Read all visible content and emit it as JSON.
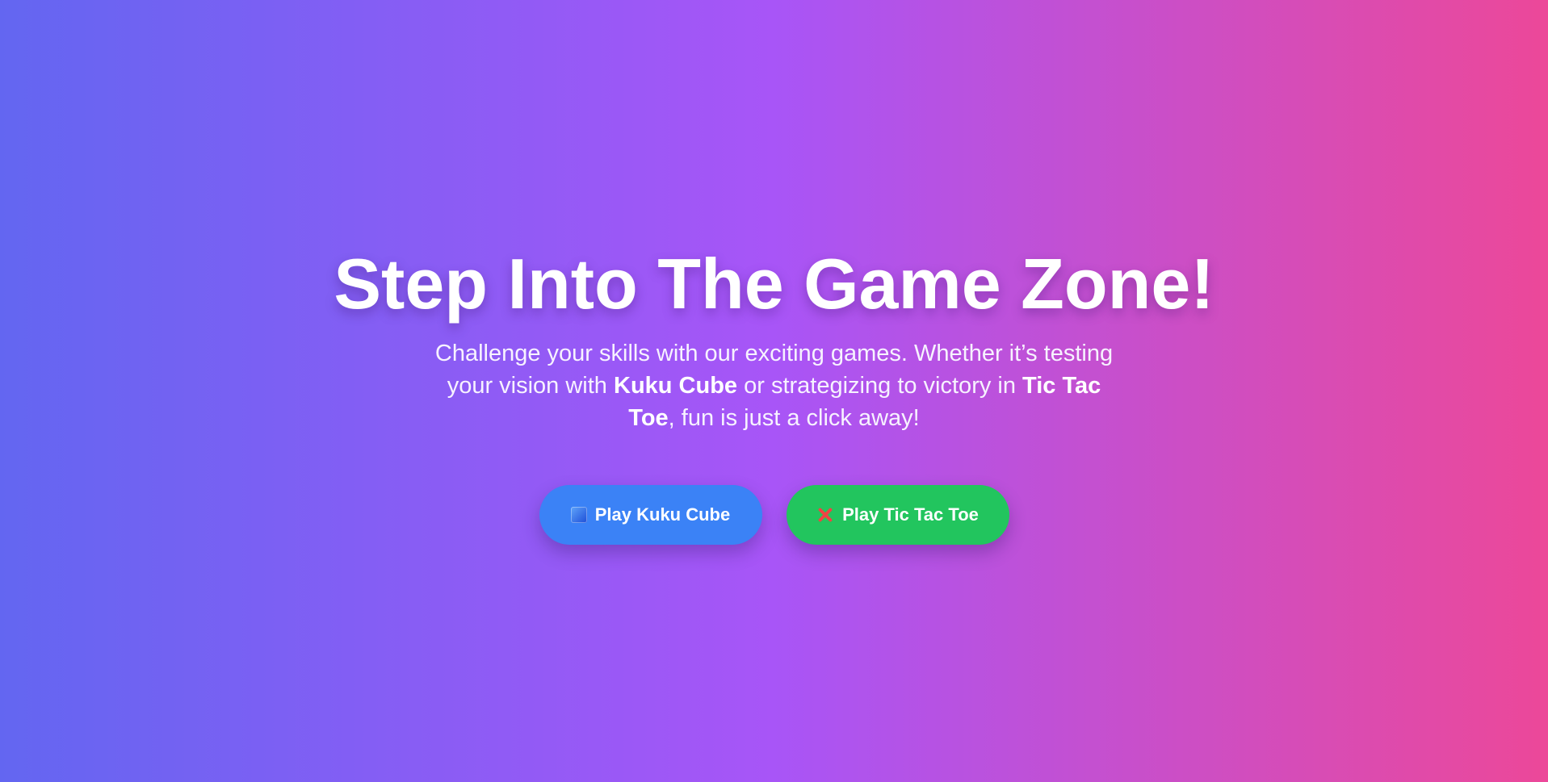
{
  "hero": {
    "title": "Step Into The Game Zone!",
    "description": {
      "part1": "Challenge your skills with our exciting games. Whether it’s testing your vision with ",
      "game1": "Kuku Cube",
      "part2": " or strategizing to victory in ",
      "game2": "Tic Tac Toe",
      "part3": ", fun is just a click away!"
    }
  },
  "buttons": [
    {
      "label": "Play Kuku Cube",
      "icon": "blue-square-icon",
      "color": "#3b82f6"
    },
    {
      "label": "Play Tic Tac Toe",
      "icon": "red-x-icon",
      "color": "#22c55e"
    }
  ],
  "colors": {
    "gradient_start": "#6366f1",
    "gradient_mid": "#a855f7",
    "gradient_end": "#ec4899"
  }
}
